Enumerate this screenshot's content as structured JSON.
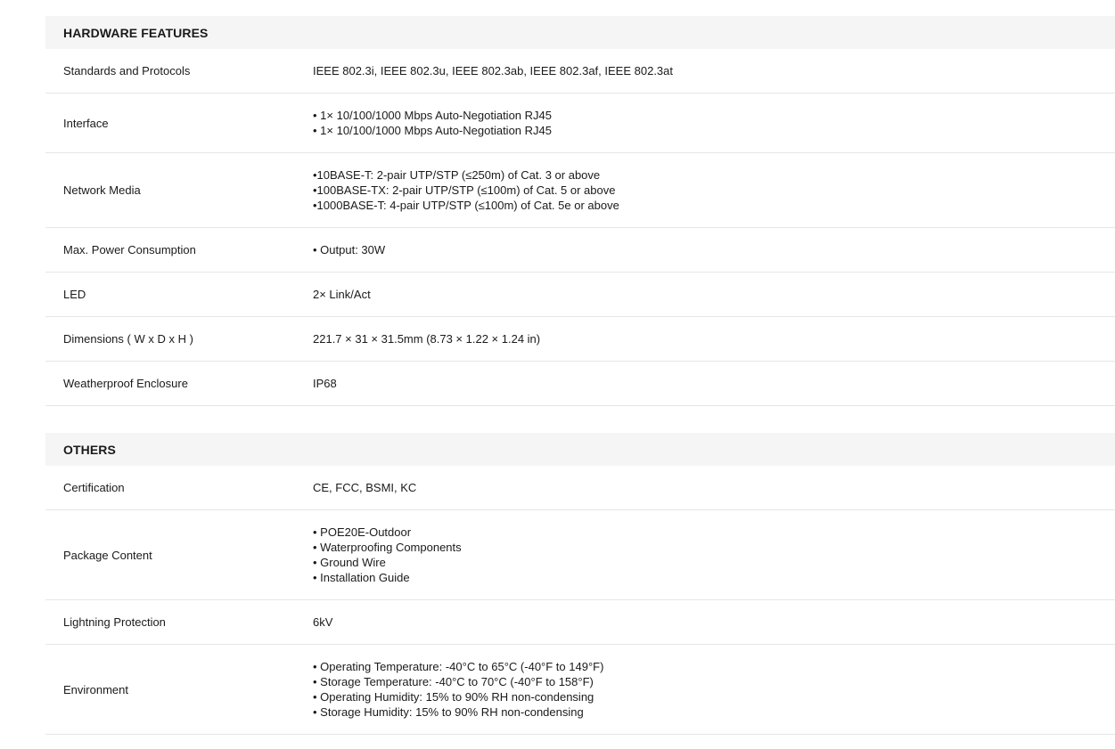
{
  "sections": [
    {
      "title": "HARDWARE FEATURES",
      "rows": [
        {
          "label": "Standards and Protocols",
          "lines": [
            "IEEE 802.3i, IEEE 802.3u, IEEE 802.3ab, IEEE 802.3af, IEEE 802.3at"
          ]
        },
        {
          "label": "Interface",
          "lines": [
            "• 1× 10/100/1000 Mbps Auto-Negotiation RJ45",
            "• 1× 10/100/1000 Mbps Auto-Negotiation RJ45"
          ]
        },
        {
          "label": "Network Media",
          "lines": [
            "•10BASE-T: 2-pair UTP/STP (≤250m) of Cat. 3 or above",
            "•100BASE-TX: 2-pair UTP/STP (≤100m) of Cat. 5 or above",
            "•1000BASE-T: 4-pair UTP/STP (≤100m) of Cat. 5e or above"
          ]
        },
        {
          "label": "Max. Power Consumption",
          "lines": [
            "• Output: 30W"
          ]
        },
        {
          "label": "LED",
          "lines": [
            "2× Link/Act"
          ]
        },
        {
          "label": "Dimensions ( W x D x H )",
          "lines": [
            "221.7 × 31 × 31.5mm (8.73 × 1.22 × 1.24 in)"
          ]
        },
        {
          "label": "Weatherproof Enclosure",
          "lines": [
            "IP68"
          ]
        }
      ]
    },
    {
      "title": "OTHERS",
      "rows": [
        {
          "label": "Certification",
          "lines": [
            "CE, FCC, BSMI, KC"
          ]
        },
        {
          "label": "Package Content",
          "lines": [
            "• POE20E-Outdoor",
            "• Waterproofing Components",
            "• Ground Wire",
            "• Installation Guide"
          ]
        },
        {
          "label": "Lightning Protection",
          "lines": [
            "6kV"
          ]
        },
        {
          "label": "Environment",
          "lines": [
            "• Operating Temperature: -40°C to 65°C (-40°F to 149°F)",
            "• Storage Temperature: -40°C to 70°C (-40°F to 158°F)",
            "• Operating Humidity: 15% to 90% RH non-condensing",
            "• Storage Humidity: 15% to 90% RH non-condensing"
          ]
        }
      ]
    }
  ]
}
